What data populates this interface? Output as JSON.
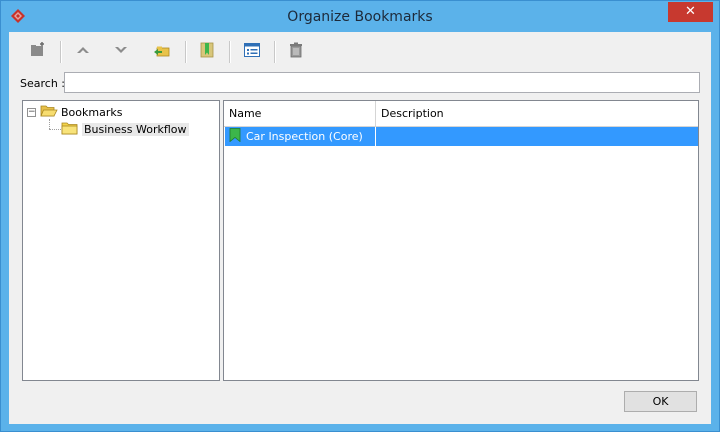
{
  "window": {
    "title": "Organize Bookmarks",
    "close_label": "✕"
  },
  "toolbar": {
    "buttons": [
      {
        "icon": "new-folder-icon"
      },
      {
        "icon": "move-up-icon"
      },
      {
        "icon": "move-down-icon"
      },
      {
        "icon": "move-to-folder-icon"
      },
      {
        "icon": "bookmark-icon"
      },
      {
        "icon": "properties-icon"
      },
      {
        "icon": "delete-icon"
      }
    ]
  },
  "search": {
    "label": "Search :",
    "value": "",
    "placeholder": ""
  },
  "tree": {
    "root": {
      "label": "Bookmarks",
      "expander": "−"
    },
    "children": [
      {
        "label": "Business Workflow"
      }
    ]
  },
  "list": {
    "columns": [
      "Name",
      "Description"
    ],
    "rows": [
      {
        "name": "Car Inspection (Core)",
        "description": "",
        "selected": true
      }
    ]
  },
  "buttons": {
    "ok": "OK"
  },
  "colors": {
    "titlebar": "#5bb2ea",
    "close": "#c7392f",
    "selection": "#3399ff",
    "bookmark_green": "#3cb64a",
    "folder_yellow": "#f3d34a"
  }
}
